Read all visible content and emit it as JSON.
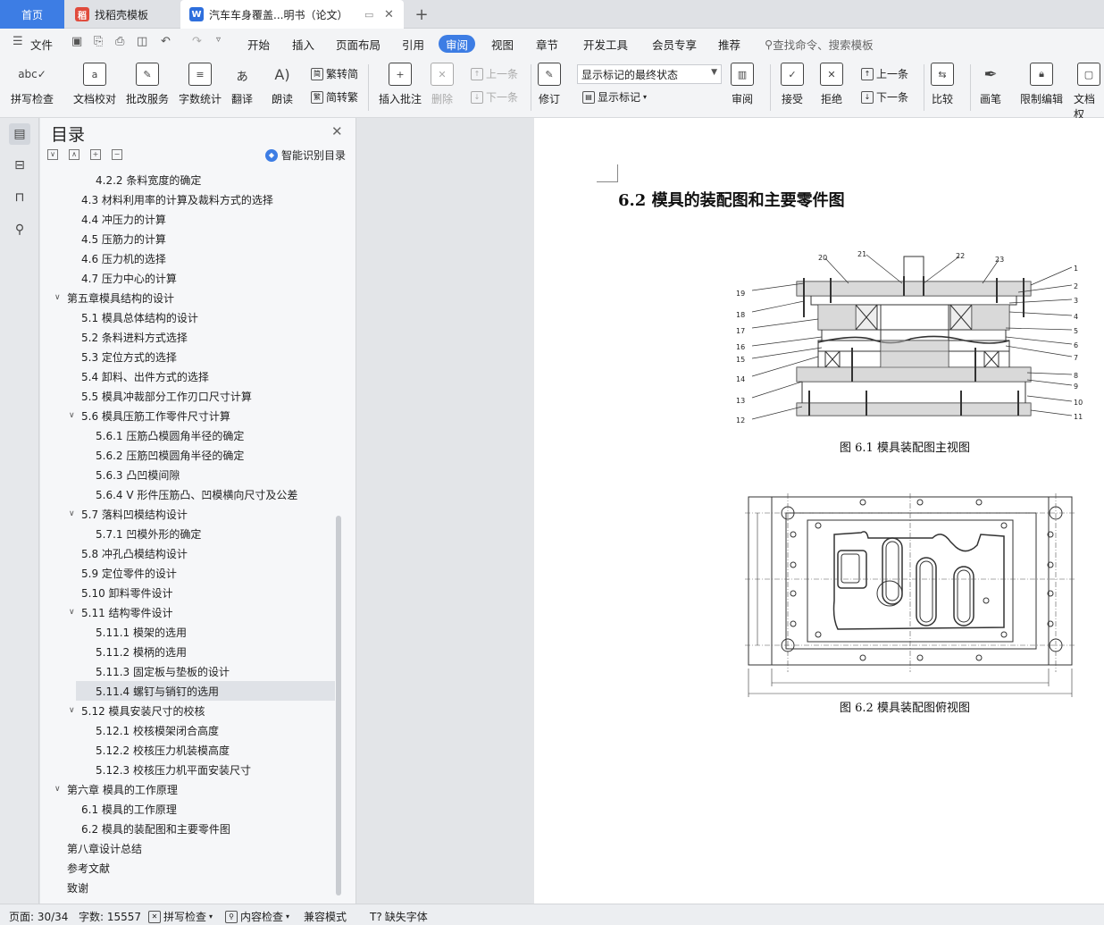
{
  "tabs": {
    "home": "首页",
    "template": "找稻壳模板",
    "document": "汽车车身覆盖...明书（论文）"
  },
  "menu": {
    "file": "文件",
    "items": [
      "开始",
      "插入",
      "页面布局",
      "引用",
      "审阅",
      "视图",
      "章节",
      "开发工具",
      "会员专享",
      "推荐"
    ],
    "search": "查找命令、搜索模板"
  },
  "ribbon": {
    "spell": "拼写检查",
    "proofread": "文档校对",
    "revise_service": "批改服务",
    "word_count": "字数统计",
    "translate": "翻译",
    "read_aloud": "朗读",
    "trad": "繁转简",
    "simp": "简转繁",
    "insert_comment": "插入批注",
    "delete": "删除",
    "prev_comment": "上一条",
    "next_comment": "下一条",
    "track": "修订",
    "markup_state": "显示标记的最终状态",
    "show_markup": "显示标记",
    "review": "审阅",
    "accept": "接受",
    "reject": "拒绝",
    "prev_change": "上一条",
    "next_change": "下一条",
    "compare": "比较",
    "pen": "画笔",
    "restrict": "限制编辑",
    "doc_perm": "文档权"
  },
  "toc": {
    "title": "目录",
    "smart": "智能识别目录",
    "items": [
      "4.2.2 条料宽度的确定",
      "4.3 材料利用率的计算及裁料方式的选择",
      "4.4 冲压力的计算",
      "4.5 压筋力的计算",
      "4.6 压力机的选择",
      "4.7 压力中心的计算",
      "第五章模具结构的设计",
      "5.1 模具总体结构的设计",
      "5.2 条料进料方式选择",
      "5.3 定位方式的选择",
      "5.4 卸料、出件方式的选择",
      "5.5 模具冲裁部分工作刃口尺寸计算",
      "5.6 模具压筋工作零件尺寸计算",
      "5.6.1 压筋凸模圆角半径的确定",
      "5.6.2 压筋凹模圆角半径的确定",
      "5.6.3 凸凹模间隙",
      "5.6.4 V 形件压筋凸、凹模横向尺寸及公差",
      "5.7 落料凹模结构设计",
      "5.7.1 凹模外形的确定",
      "5.8 冲孔凸模结构设计",
      "5.9 定位零件的设计",
      "5.10 卸料零件设计",
      "5.11 结构零件设计",
      "5.11.1 模架的选用",
      "5.11.2 模柄的选用",
      "5.11.3 固定板与垫板的设计",
      "5.11.4 螺钉与销钉的选用",
      "5.12 模具安装尺寸的校核",
      "5.12.1 校核模架闭合高度",
      "5.12.2 校核压力机装模高度",
      "5.12.3 校核压力机平面安装尺寸",
      "第六章 模具的工作原理",
      "6.1 模具的工作原理",
      "6.2 模具的装配图和主要零件图",
      "第八章设计总结",
      "参考文献",
      "致谢"
    ]
  },
  "doc": {
    "heading": "6.2 模具的装配图和主要零件图",
    "fig1_caption": "图 6.1 模具装配图主视图",
    "fig2_caption": "图 6.2 模具装配图俯视图",
    "left_labels": [
      "19",
      "18",
      "17",
      "16",
      "15",
      "14",
      "13",
      "12"
    ],
    "right_labels": [
      "1",
      "2",
      "3",
      "4",
      "5",
      "6",
      "7",
      "8",
      "9",
      "10",
      "11"
    ],
    "top_labels": [
      "20",
      "21",
      "22",
      "23"
    ]
  },
  "status": {
    "page": "页面: 30/34",
    "words": "字数: 15557",
    "spell": "拼写检查",
    "content": "内容检查",
    "compat": "兼容模式",
    "missing_font": "缺失字体"
  }
}
